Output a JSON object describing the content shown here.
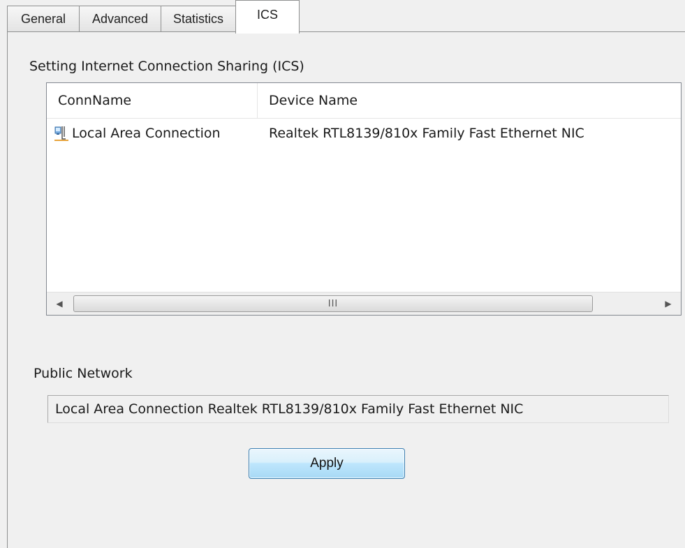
{
  "tabs": [
    {
      "label": "General",
      "active": false
    },
    {
      "label": "Advanced",
      "active": false
    },
    {
      "label": "Statistics",
      "active": false
    },
    {
      "label": "ICS",
      "active": true
    }
  ],
  "ics": {
    "group_title": "Setting Internet Connection Sharing (ICS)",
    "list": {
      "columns": [
        "ConnName",
        "Device Name"
      ],
      "rows": [
        {
          "icon": "network-connection-icon",
          "conn_name": "Local Area Connection",
          "device_name": "Realtek RTL8139/810x Family Fast Ethernet NIC"
        }
      ],
      "scrollbar_grip": "III"
    },
    "public_network_label": "Public Network",
    "public_network_value": "Local Area Connection Realtek RTL8139/810x Family Fast Ethernet NIC",
    "apply_label": "Apply"
  }
}
